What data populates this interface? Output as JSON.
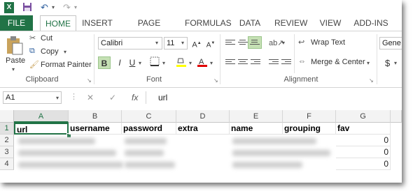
{
  "quick_access": {
    "app_icon": "excel-icon",
    "save_icon": "save-icon",
    "undo_icon": "undo-icon",
    "redo_icon": "redo-icon"
  },
  "tabs": [
    {
      "label": "FILE"
    },
    {
      "label": "HOME"
    },
    {
      "label": "INSERT"
    },
    {
      "label": "PAGE LAYOUT"
    },
    {
      "label": "FORMULAS"
    },
    {
      "label": "DATA"
    },
    {
      "label": "REVIEW"
    },
    {
      "label": "VIEW"
    },
    {
      "label": "ADD-INS"
    }
  ],
  "clipboard": {
    "paste": "Paste",
    "cut": "Cut",
    "copy": "Copy",
    "format_painter": "Format Painter",
    "group": "Clipboard"
  },
  "font": {
    "name": "Calibri",
    "size": "11",
    "bold": "B",
    "italic": "I",
    "underline": "U",
    "group": "Font"
  },
  "alignment": {
    "wrap_text": "Wrap Text",
    "merge_center": "Merge & Center",
    "group": "Alignment"
  },
  "number": {
    "format": "Gene",
    "currency": "$"
  },
  "formula_bar": {
    "name_box": "A1",
    "cancel": "✕",
    "enter": "✓",
    "fx": "fx",
    "value": "url"
  },
  "columns": [
    "A",
    "B",
    "C",
    "D",
    "E",
    "F",
    "G"
  ],
  "rows": [
    "1",
    "2",
    "3",
    "4"
  ],
  "header_row": [
    "url",
    "username",
    "password",
    "extra",
    "name",
    "grouping",
    "fav"
  ],
  "fav_values": [
    "0",
    "0",
    "0"
  ],
  "colors": {
    "accent": "#217346",
    "file_tab": "#217346",
    "selected_button": "#c5e0b4"
  }
}
